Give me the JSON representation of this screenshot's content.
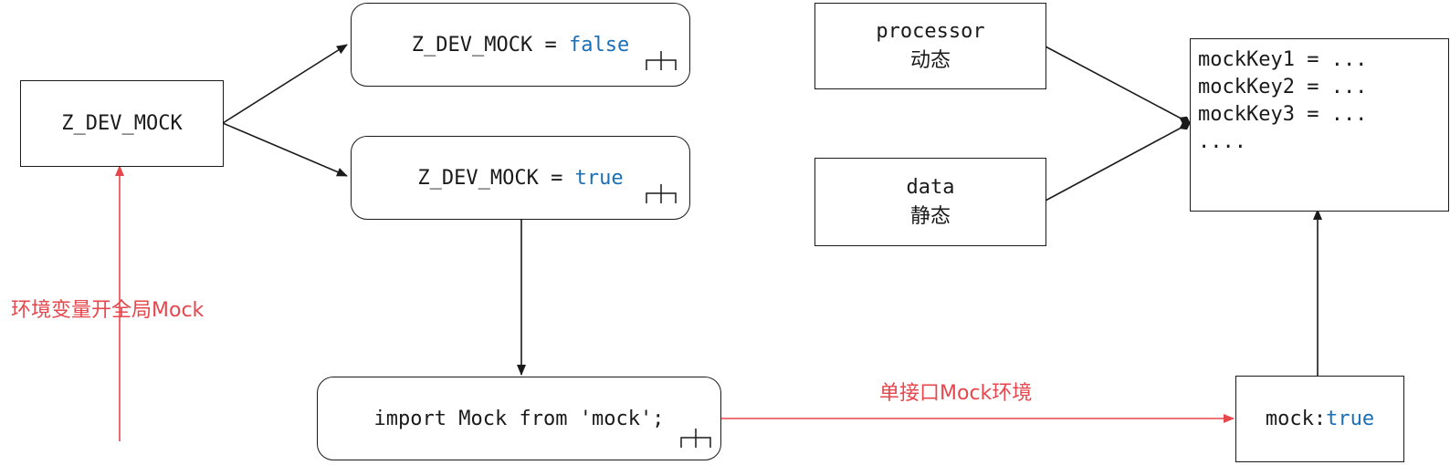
{
  "colors": {
    "line": "#1a1a1a",
    "highlight": "#e5474d",
    "keyword": "#1a6fb8"
  },
  "nodes": {
    "env_var": {
      "text": "Z_DEV_MOCK"
    },
    "false_branch": {
      "prefix": "Z_DEV_MOCK = ",
      "value": "false",
      "icon": "fork-icon"
    },
    "true_branch": {
      "prefix": "Z_DEV_MOCK = ",
      "value": "true",
      "icon": "fork-icon"
    },
    "import_stmt": {
      "text": "import Mock from 'mock';",
      "icon": "fork-icon"
    },
    "processor": {
      "title": "processor",
      "subtitle": "动态"
    },
    "data": {
      "title": "data",
      "subtitle": "静态"
    },
    "mock_keys": {
      "lines": [
        "mockKey1 = ...",
        "mockKey2 = ...",
        "mockKey3 = ...",
        "...."
      ]
    },
    "mock_flag": {
      "prefix": "mock:",
      "value": "true"
    }
  },
  "labels": {
    "global_mock": "环境变量开全局Mock",
    "single_api": "单接口Mock环境"
  }
}
